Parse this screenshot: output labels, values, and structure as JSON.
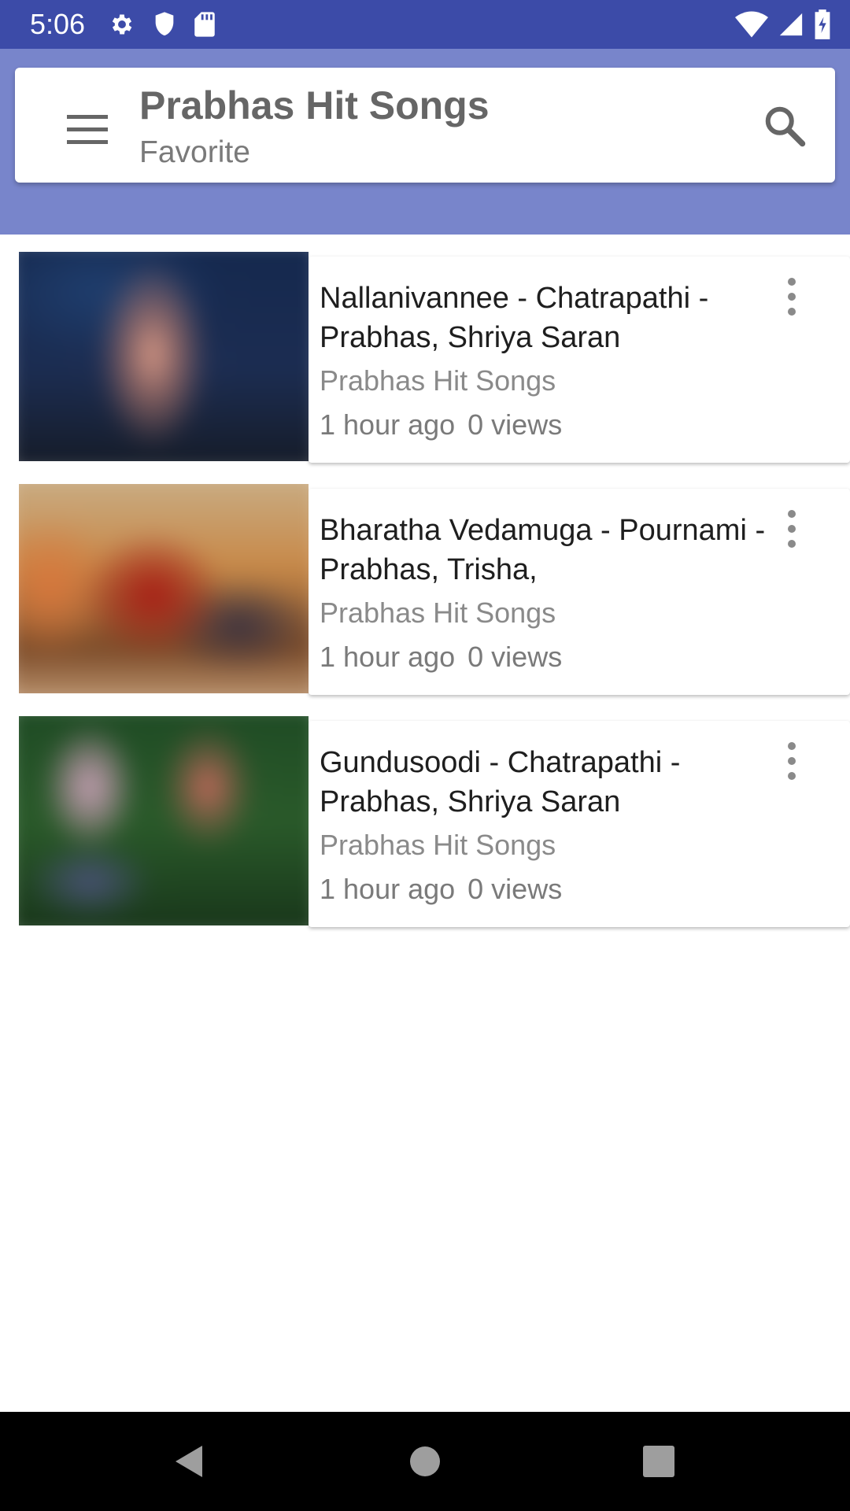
{
  "status_bar": {
    "time": "5:06",
    "left_icons": [
      "settings-icon",
      "shield-icon",
      "sd-card-icon"
    ],
    "right_icons": [
      "wifi-icon",
      "signal-icon",
      "battery-icon"
    ],
    "background": "#3c4ba8"
  },
  "app_bar": {
    "title": "Prabhas Hit Songs",
    "subtitle": "Favorite",
    "menu_icon": "menu-icon",
    "search_icon": "search-icon",
    "background": "#7885cb"
  },
  "videos": [
    {
      "title": "Nallanivannee - Chatrapathi - Prabhas, Shriya Saran",
      "channel": "Prabhas Hit Songs",
      "time": "1 hour ago",
      "views": "0 views"
    },
    {
      "title": "Bharatha Vedamuga - Pournami - Prabhas, Trisha,",
      "channel": "Prabhas Hit Songs",
      "time": "1 hour ago",
      "views": "0 views"
    },
    {
      "title": "Gundusoodi - Chatrapathi - Prabhas, Shriya Saran",
      "channel": "Prabhas Hit Songs",
      "time": "1 hour ago",
      "views": "0 views"
    }
  ],
  "nav_bar": {
    "buttons": [
      "back-icon",
      "home-icon",
      "recents-icon"
    ]
  }
}
